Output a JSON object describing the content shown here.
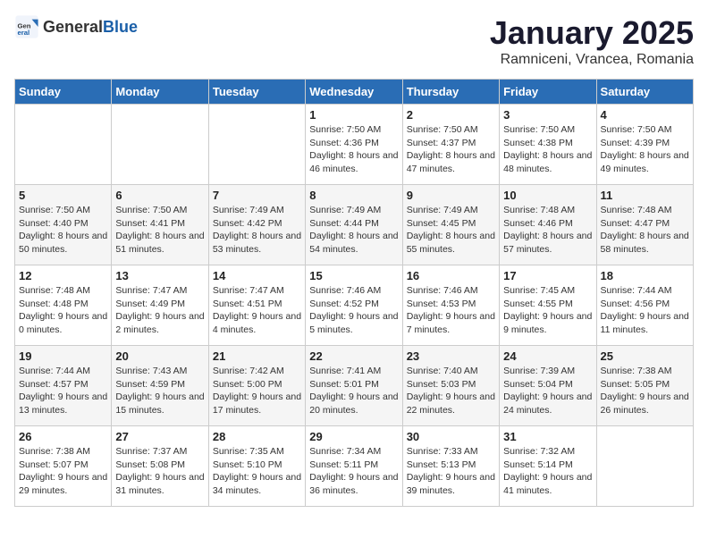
{
  "header": {
    "logo_general": "General",
    "logo_blue": "Blue",
    "title": "January 2025",
    "subtitle": "Ramniceni, Vrancea, Romania"
  },
  "weekdays": [
    "Sunday",
    "Monday",
    "Tuesday",
    "Wednesday",
    "Thursday",
    "Friday",
    "Saturday"
  ],
  "weeks": [
    [
      {
        "day": "",
        "info": ""
      },
      {
        "day": "",
        "info": ""
      },
      {
        "day": "",
        "info": ""
      },
      {
        "day": "1",
        "info": "Sunrise: 7:50 AM\nSunset: 4:36 PM\nDaylight: 8 hours and 46 minutes."
      },
      {
        "day": "2",
        "info": "Sunrise: 7:50 AM\nSunset: 4:37 PM\nDaylight: 8 hours and 47 minutes."
      },
      {
        "day": "3",
        "info": "Sunrise: 7:50 AM\nSunset: 4:38 PM\nDaylight: 8 hours and 48 minutes."
      },
      {
        "day": "4",
        "info": "Sunrise: 7:50 AM\nSunset: 4:39 PM\nDaylight: 8 hours and 49 minutes."
      }
    ],
    [
      {
        "day": "5",
        "info": "Sunrise: 7:50 AM\nSunset: 4:40 PM\nDaylight: 8 hours and 50 minutes."
      },
      {
        "day": "6",
        "info": "Sunrise: 7:50 AM\nSunset: 4:41 PM\nDaylight: 8 hours and 51 minutes."
      },
      {
        "day": "7",
        "info": "Sunrise: 7:49 AM\nSunset: 4:42 PM\nDaylight: 8 hours and 53 minutes."
      },
      {
        "day": "8",
        "info": "Sunrise: 7:49 AM\nSunset: 4:44 PM\nDaylight: 8 hours and 54 minutes."
      },
      {
        "day": "9",
        "info": "Sunrise: 7:49 AM\nSunset: 4:45 PM\nDaylight: 8 hours and 55 minutes."
      },
      {
        "day": "10",
        "info": "Sunrise: 7:48 AM\nSunset: 4:46 PM\nDaylight: 8 hours and 57 minutes."
      },
      {
        "day": "11",
        "info": "Sunrise: 7:48 AM\nSunset: 4:47 PM\nDaylight: 8 hours and 58 minutes."
      }
    ],
    [
      {
        "day": "12",
        "info": "Sunrise: 7:48 AM\nSunset: 4:48 PM\nDaylight: 9 hours and 0 minutes."
      },
      {
        "day": "13",
        "info": "Sunrise: 7:47 AM\nSunset: 4:49 PM\nDaylight: 9 hours and 2 minutes."
      },
      {
        "day": "14",
        "info": "Sunrise: 7:47 AM\nSunset: 4:51 PM\nDaylight: 9 hours and 4 minutes."
      },
      {
        "day": "15",
        "info": "Sunrise: 7:46 AM\nSunset: 4:52 PM\nDaylight: 9 hours and 5 minutes."
      },
      {
        "day": "16",
        "info": "Sunrise: 7:46 AM\nSunset: 4:53 PM\nDaylight: 9 hours and 7 minutes."
      },
      {
        "day": "17",
        "info": "Sunrise: 7:45 AM\nSunset: 4:55 PM\nDaylight: 9 hours and 9 minutes."
      },
      {
        "day": "18",
        "info": "Sunrise: 7:44 AM\nSunset: 4:56 PM\nDaylight: 9 hours and 11 minutes."
      }
    ],
    [
      {
        "day": "19",
        "info": "Sunrise: 7:44 AM\nSunset: 4:57 PM\nDaylight: 9 hours and 13 minutes."
      },
      {
        "day": "20",
        "info": "Sunrise: 7:43 AM\nSunset: 4:59 PM\nDaylight: 9 hours and 15 minutes."
      },
      {
        "day": "21",
        "info": "Sunrise: 7:42 AM\nSunset: 5:00 PM\nDaylight: 9 hours and 17 minutes."
      },
      {
        "day": "22",
        "info": "Sunrise: 7:41 AM\nSunset: 5:01 PM\nDaylight: 9 hours and 20 minutes."
      },
      {
        "day": "23",
        "info": "Sunrise: 7:40 AM\nSunset: 5:03 PM\nDaylight: 9 hours and 22 minutes."
      },
      {
        "day": "24",
        "info": "Sunrise: 7:39 AM\nSunset: 5:04 PM\nDaylight: 9 hours and 24 minutes."
      },
      {
        "day": "25",
        "info": "Sunrise: 7:38 AM\nSunset: 5:05 PM\nDaylight: 9 hours and 26 minutes."
      }
    ],
    [
      {
        "day": "26",
        "info": "Sunrise: 7:38 AM\nSunset: 5:07 PM\nDaylight: 9 hours and 29 minutes."
      },
      {
        "day": "27",
        "info": "Sunrise: 7:37 AM\nSunset: 5:08 PM\nDaylight: 9 hours and 31 minutes."
      },
      {
        "day": "28",
        "info": "Sunrise: 7:35 AM\nSunset: 5:10 PM\nDaylight: 9 hours and 34 minutes."
      },
      {
        "day": "29",
        "info": "Sunrise: 7:34 AM\nSunset: 5:11 PM\nDaylight: 9 hours and 36 minutes."
      },
      {
        "day": "30",
        "info": "Sunrise: 7:33 AM\nSunset: 5:13 PM\nDaylight: 9 hours and 39 minutes."
      },
      {
        "day": "31",
        "info": "Sunrise: 7:32 AM\nSunset: 5:14 PM\nDaylight: 9 hours and 41 minutes."
      },
      {
        "day": "",
        "info": ""
      }
    ]
  ]
}
